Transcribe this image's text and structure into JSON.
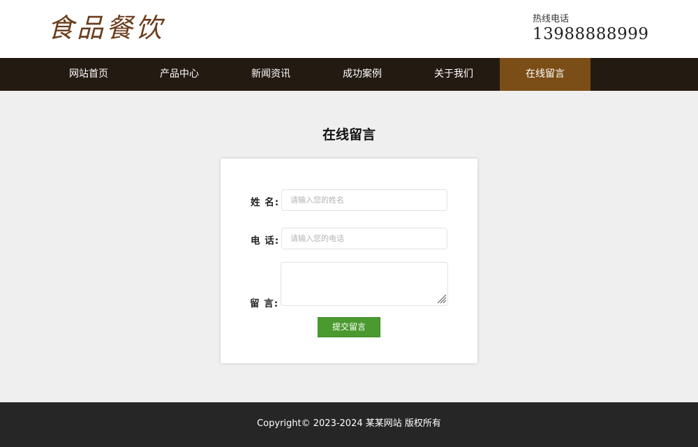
{
  "header": {
    "logo_text": "食品餐饮",
    "hotline_label": "热线电话",
    "hotline_number": "13988888999"
  },
  "nav": {
    "items": [
      {
        "label": "网站首页",
        "active": false
      },
      {
        "label": "产品中心",
        "active": false
      },
      {
        "label": "新闻资讯",
        "active": false
      },
      {
        "label": "成功案例",
        "active": false
      },
      {
        "label": "关于我们",
        "active": false
      },
      {
        "label": "在线留言",
        "active": true
      }
    ]
  },
  "main": {
    "title": "在线留言",
    "form": {
      "name_label": "姓 名:",
      "name_placeholder": "请输入您的姓名",
      "name_value": "",
      "phone_label": "电 话:",
      "phone_placeholder": "请输入您的电话",
      "phone_value": "",
      "message_label": "留 言:",
      "message_value": "",
      "submit_label": "提交留言"
    }
  },
  "footer": {
    "copyright": "Copyright© 2023-2024 某某网站 版权所有"
  },
  "colors": {
    "nav_bg": "#231a12",
    "nav_active": "#7b4d17",
    "logo": "#6b3d1c",
    "submit": "#4a9a2f",
    "footer_bg": "#262626",
    "page_bg": "#efefef"
  }
}
